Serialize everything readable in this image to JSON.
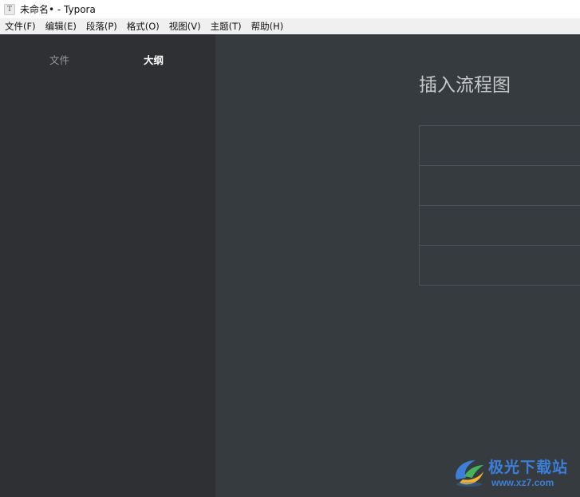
{
  "window": {
    "title": "未命名• - Typora",
    "app_icon_glyph": "T"
  },
  "menubar": {
    "items": [
      {
        "label": "文件(F)"
      },
      {
        "label": "编辑(E)"
      },
      {
        "label": "段落(P)"
      },
      {
        "label": "格式(O)"
      },
      {
        "label": "视图(V)"
      },
      {
        "label": "主题(T)"
      },
      {
        "label": "帮助(H)"
      }
    ]
  },
  "sidebar": {
    "tabs": {
      "files": "文件",
      "outline": "大纲"
    },
    "active_tab": "outline"
  },
  "editor": {
    "heading": "插入流程图",
    "table_rows": 4
  },
  "watermark": {
    "name": "极光下载站",
    "url": "www.xz7.com"
  },
  "colors": {
    "sidebar_bg": "#2e3033",
    "editor_bg": "#363b40",
    "heading_text": "#c8c9ca",
    "watermark_blue": "#3d7fd8"
  }
}
